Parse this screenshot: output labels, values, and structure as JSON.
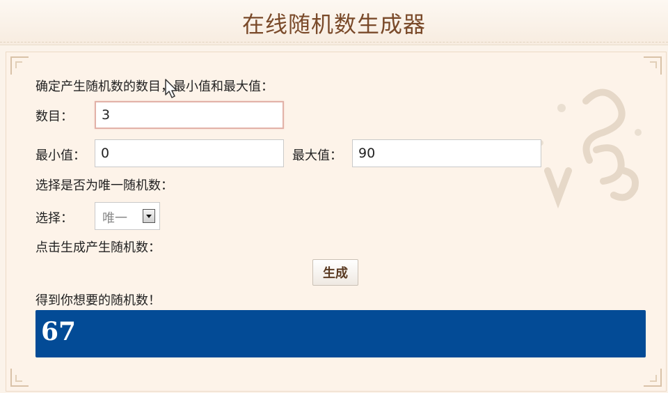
{
  "header": {
    "title": "在线随机数生成器"
  },
  "form": {
    "intro_label": "确定产生随机数的数目，最小值和最大值：",
    "count_label": "数目：",
    "count_value": "3",
    "min_label": "最小值：",
    "min_value": "0",
    "max_label": "最大值：",
    "max_value": "90",
    "unique_prompt": "选择是否为唯一随机数：",
    "choose_label": "选择：",
    "unique_selected": "唯一",
    "generate_prompt": "点击生成产生随机数：",
    "generate_button": "生成",
    "result_label": "得到你想要的随机数！",
    "result_value": "67"
  },
  "colors": {
    "result_bg": "#034b96",
    "title": "#7a4a2a",
    "panel_bg": "#fdf3e9"
  },
  "icons": {
    "select_arrow": "chevron-down-icon",
    "cursor": "mouse-pointer-icon"
  }
}
